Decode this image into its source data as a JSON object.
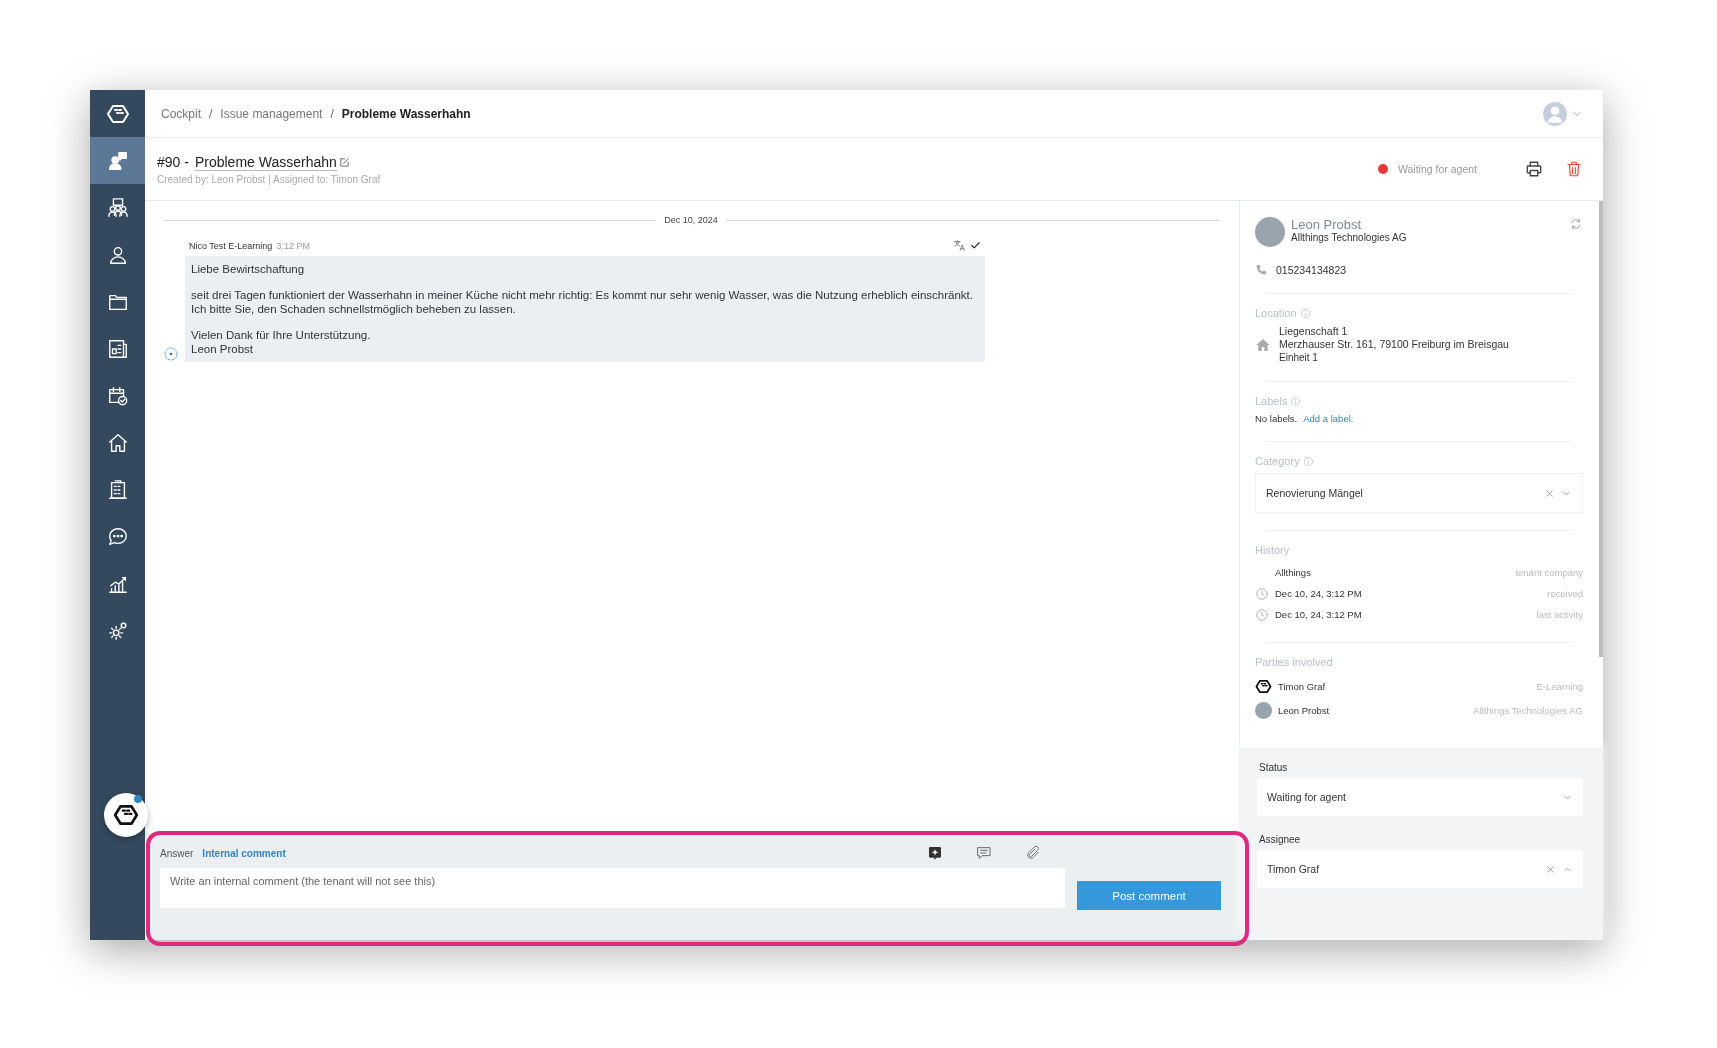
{
  "sidebar": {
    "items": [
      {
        "kind": "tickets",
        "selected": true
      },
      {
        "kind": "people",
        "selected": false
      },
      {
        "kind": "person",
        "selected": false
      },
      {
        "kind": "folder",
        "selected": false
      },
      {
        "kind": "report",
        "selected": false
      },
      {
        "kind": "calendar",
        "selected": false
      },
      {
        "kind": "home",
        "selected": false
      },
      {
        "kind": "building",
        "selected": false
      },
      {
        "kind": "chat",
        "selected": false
      },
      {
        "kind": "chart",
        "selected": false
      },
      {
        "kind": "settings",
        "selected": false
      }
    ]
  },
  "breadcrumb": [
    {
      "label": "Cockpit",
      "current": false
    },
    {
      "separator": "/",
      "label": "Issue management",
      "current": false
    },
    {
      "separator": "/",
      "label": "Probleme Wasserhahn",
      "current": true
    }
  ],
  "ticket": {
    "number": "#90 -",
    "title": "Probleme Wasserhahn",
    "meta": "Created by: Leon Probst | Assigned to: Timon Graf",
    "status": "Waiting for agent"
  },
  "thread": {
    "date": "Dec 10, 2024",
    "messages": [
      {
        "author": "Nico Test E-Learning",
        "time": "3:12 PM",
        "paragraphs": [
          [
            "Liebe Bewirtschaftung"
          ],
          [
            "seit drei Tagen funktioniert der Wasserhahn in meiner Küche nicht mehr richtig: Es kommt nur sehr wenig Wasser, was die Nutzung erheblich einschränkt. Ich bitte Sie, den Schaden schnellstmöglich beheben zu lassen."
          ],
          [
            "Vielen Dank für Ihre Unterstützung.",
            "Leon Probst"
          ]
        ]
      }
    ]
  },
  "composer": {
    "tabs": [
      {
        "label": "Answer",
        "selected": false
      },
      {
        "label": "Internal comment",
        "selected": true
      }
    ],
    "placeholder": "Write an internal comment (the tenant will not see this)",
    "button": "Post comment"
  },
  "contact": {
    "name": "Leon Probst",
    "company": "Allthings Technologies AG",
    "phone": "015234134823"
  },
  "location": {
    "title": "Location",
    "lines": [
      "Liegenschaft 1",
      "Merzhauser Str. 161, 79100 Freiburg im Breisgau",
      "Einheit 1"
    ]
  },
  "labels": {
    "title": "Labels",
    "empty": "No labels.",
    "link": "Add a label."
  },
  "category": {
    "title": "Category",
    "value": "Renovierung Mängel"
  },
  "history": {
    "title": "History",
    "rows": [
      {
        "kind": "plain",
        "value": "Allthings",
        "note": "tenant company"
      },
      {
        "kind": "time",
        "value": "Dec 10, 24, 3:12 PM",
        "note": "received"
      },
      {
        "kind": "time",
        "value": "Dec 10, 24, 3:12 PM",
        "note": "last activity"
      }
    ]
  },
  "parties": {
    "title": "Parties involved",
    "rows": [
      {
        "kind": "logo",
        "name": "Timon Graf",
        "org": "E-Learning"
      },
      {
        "kind": "avatar",
        "name": "Leon Probst",
        "org": "Allthings Technologies AG"
      }
    ]
  },
  "status_field": {
    "label": "Status",
    "value": "Waiting for agent",
    "expanded": false
  },
  "assignee_field": {
    "label": "Assignee",
    "value": "Timon Graf",
    "expanded": true
  }
}
